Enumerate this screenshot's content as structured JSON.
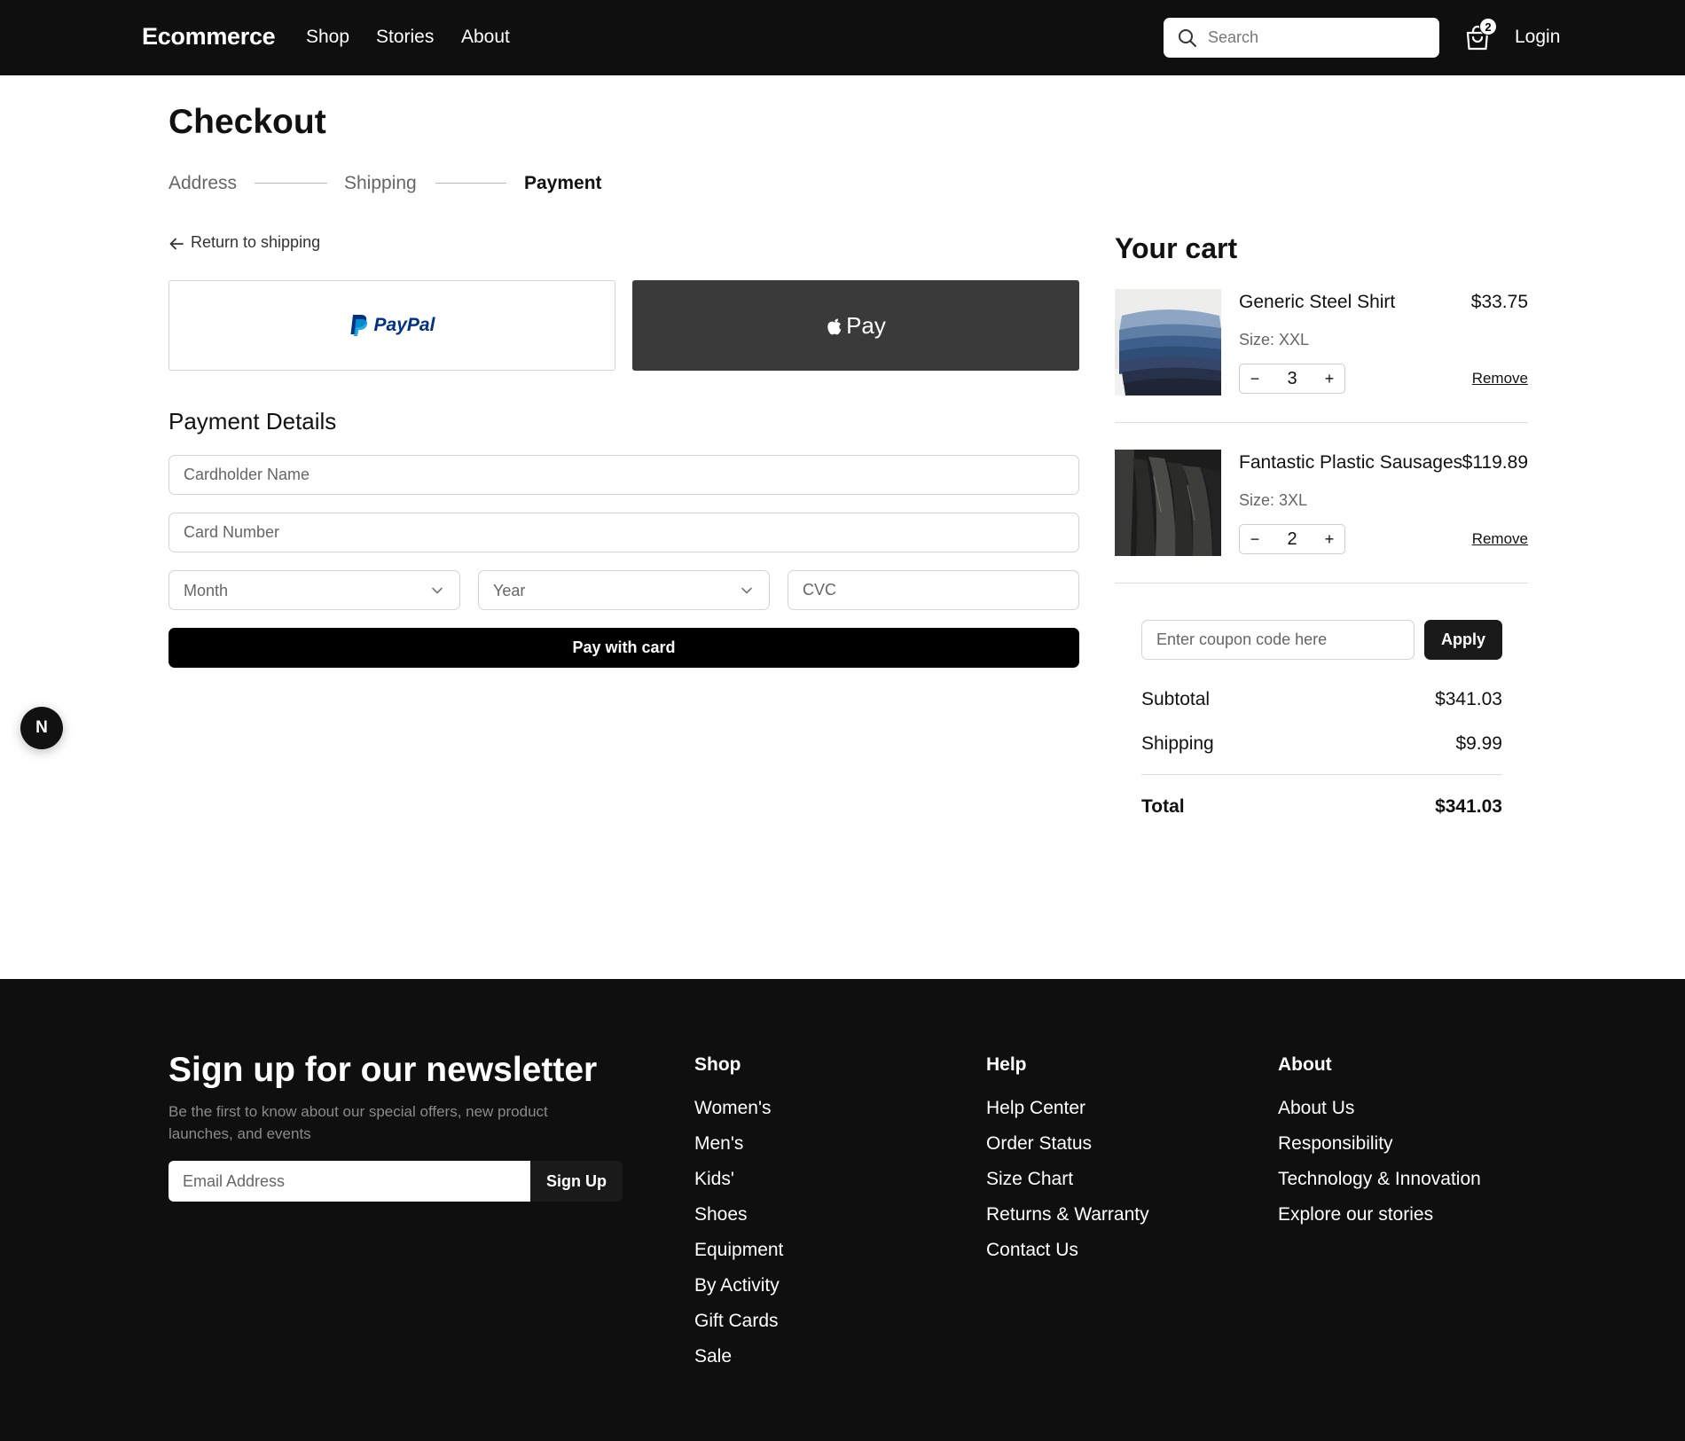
{
  "nav": {
    "brand": "Ecommerce",
    "links": [
      "Shop",
      "Stories",
      "About"
    ],
    "search_placeholder": "Search",
    "cart_count": "2",
    "login": "Login"
  },
  "checkout": {
    "title": "Checkout",
    "steps": [
      "Address",
      "Shipping",
      "Payment"
    ],
    "active_step": "Payment",
    "back_link": "Return to shipping",
    "paypal_label": "PayPal",
    "applepay_label": "Pay",
    "details_title": "Payment Details",
    "cardholder_placeholder": "Cardholder Name",
    "card_number_placeholder": "Card Number",
    "month_label": "Month",
    "year_label": "Year",
    "cvc_placeholder": "CVC",
    "pay_button": "Pay with card"
  },
  "cart": {
    "title": "Your cart",
    "items": [
      {
        "name": "Generic Steel Shirt",
        "price": "$33.75",
        "size": "Size: XXL",
        "quantity": "3",
        "remove": "Remove"
      },
      {
        "name": "Fantastic Plastic Sausages",
        "price": "$119.89",
        "size": "Size: 3XL",
        "quantity": "2",
        "remove": "Remove"
      }
    ],
    "coupon_placeholder": "Enter coupon code here",
    "apply": "Apply",
    "subtotal_label": "Subtotal",
    "subtotal": "$341.03",
    "shipping_label": "Shipping",
    "shipping": "$9.99",
    "total_label": "Total",
    "total": "$341.03"
  },
  "dev_badge": "N",
  "footer": {
    "newsletter_title": "Sign up for our newsletter",
    "newsletter_sub": "Be the first to know about our special offers, new product launches, and events",
    "email_placeholder": "Email Address",
    "signup": "Sign Up",
    "columns": [
      {
        "title": "Shop",
        "links": [
          "Women's",
          "Men's",
          "Kids'",
          "Shoes",
          "Equipment",
          "By Activity",
          "Gift Cards",
          "Sale"
        ]
      },
      {
        "title": "Help",
        "links": [
          "Help Center",
          "Order Status",
          "Size Chart",
          "Returns & Warranty",
          "Contact Us"
        ]
      },
      {
        "title": "About",
        "links": [
          "About Us",
          "Responsibility",
          "Technology & Innovation",
          "Explore our stories"
        ]
      }
    ]
  },
  "colors": {
    "nav_bg": "#0f0f0f",
    "applepay_bg": "#3a3a3a",
    "paypal_blue": "#003087",
    "paypal_light": "#009cde"
  }
}
